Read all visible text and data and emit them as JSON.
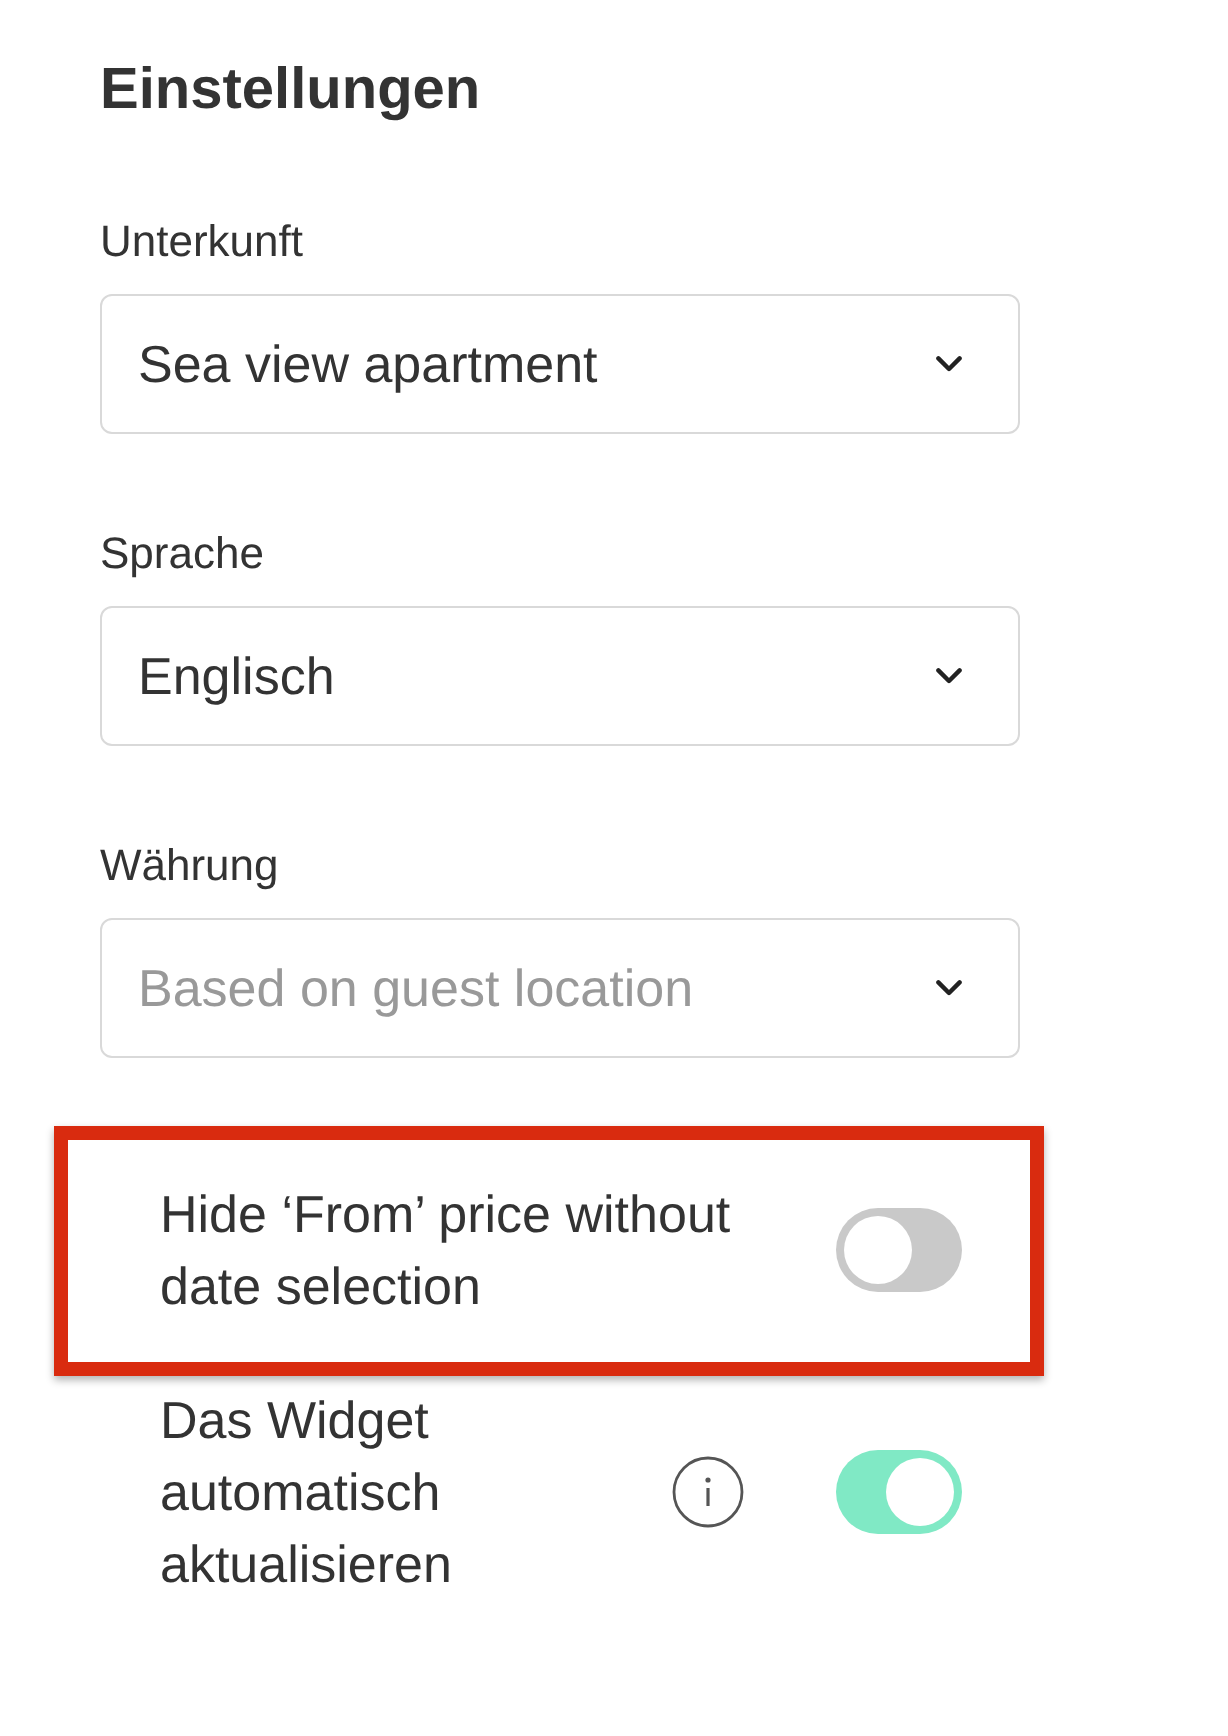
{
  "title": "Einstellungen",
  "fields": [
    {
      "label": "Unterkunft",
      "value": "Sea view apartment"
    },
    {
      "label": "Sprache",
      "value": "Englisch"
    },
    {
      "label": "Währung",
      "placeholder": "Based on guest location"
    }
  ],
  "settings": [
    {
      "label": "Hide ‘From’ price without date selection",
      "on": false,
      "info_icon": false,
      "highlighted": true
    },
    {
      "label": "Das Widget automatisch aktualisieren",
      "on": true,
      "info_icon": true,
      "highlighted": false
    }
  ]
}
